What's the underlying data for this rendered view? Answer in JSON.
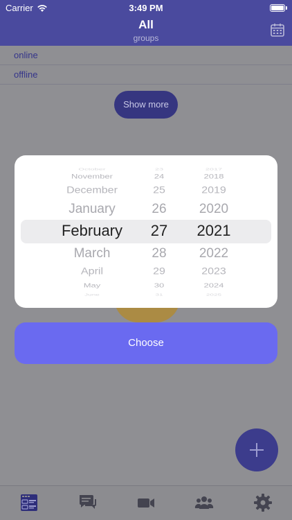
{
  "status_bar": {
    "carrier": "Carrier",
    "time": "3:49 PM"
  },
  "nav": {
    "title": "All",
    "subtitle": "groups"
  },
  "list": {
    "online": "online",
    "offline": "offline"
  },
  "show_more_label": "Show more",
  "picker": {
    "months": [
      "October",
      "November",
      "December",
      "January",
      "February",
      "March",
      "April",
      "May",
      "June"
    ],
    "days": [
      "23",
      "24",
      "25",
      "26",
      "27",
      "28",
      "29",
      "30",
      "31"
    ],
    "years": [
      "2017",
      "2018",
      "2019",
      "2020",
      "2021",
      "2022",
      "2023",
      "2024",
      "2025"
    ],
    "selected": {
      "month": "February",
      "day": "27",
      "year": "2021"
    }
  },
  "choose_label": "Choose",
  "colors": {
    "nav_bar": "#4a4a9e",
    "choose_button": "#6a6af0",
    "fab": "#3c3c8c",
    "overlay": "#8f8f93"
  },
  "tabs": [
    {
      "icon": "groups-list-icon",
      "active": true
    },
    {
      "icon": "messages-icon",
      "active": false
    },
    {
      "icon": "video-camera-icon",
      "active": false
    },
    {
      "icon": "contacts-icon",
      "active": false
    },
    {
      "icon": "settings-gear-icon",
      "active": false
    }
  ]
}
